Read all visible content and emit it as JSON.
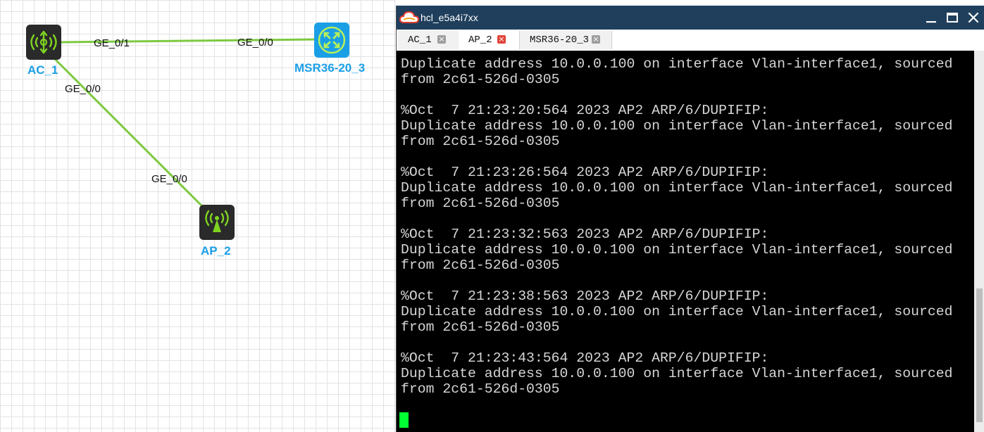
{
  "topology": {
    "devices": [
      {
        "label": "AC_1",
        "icon": "wireless-controller-icon"
      },
      {
        "label": "MSR36-20_3",
        "icon": "router-icon"
      },
      {
        "label": "AP_2",
        "icon": "access-point-icon"
      }
    ],
    "ports": {
      "ac1_to_msr": "GE_0/1",
      "msr_to_ac1": "GE_0/0",
      "ac1_to_ap2": "GE_0/0",
      "ap2_to_ac1": "GE_0/0"
    },
    "colors": {
      "link": "#7dc942",
      "device_bg": "#2a2a2a",
      "device_glyph": "#7ed321",
      "router_bg": "#1a9fe6",
      "label": "#1a9fe6"
    }
  },
  "terminal": {
    "title": "hcl_e5a4i7xx",
    "tabs": [
      {
        "label": "AC_1",
        "active": false
      },
      {
        "label": "AP_2",
        "active": true
      },
      {
        "label": "MSR36-20_3",
        "active": false
      }
    ],
    "console_text": "Duplicate address 10.0.0.100 on interface Vlan-interface1, sourced\nfrom 2c61-526d-0305\n\n%Oct  7 21:23:20:564 2023 AP2 ARP/6/DUPIFIP:\nDuplicate address 10.0.0.100 on interface Vlan-interface1, sourced\nfrom 2c61-526d-0305\n\n%Oct  7 21:23:26:564 2023 AP2 ARP/6/DUPIFIP:\nDuplicate address 10.0.0.100 on interface Vlan-interface1, sourced\nfrom 2c61-526d-0305\n\n%Oct  7 21:23:32:563 2023 AP2 ARP/6/DUPIFIP:\nDuplicate address 10.0.0.100 on interface Vlan-interface1, sourced\nfrom 2c61-526d-0305\n\n%Oct  7 21:23:38:563 2023 AP2 ARP/6/DUPIFIP:\nDuplicate address 10.0.0.100 on interface Vlan-interface1, sourced\nfrom 2c61-526d-0305\n\n%Oct  7 21:23:43:564 2023 AP2 ARP/6/DUPIFIP:\nDuplicate address 10.0.0.100 on interface Vlan-interface1, sourced\nfrom 2c61-526d-0305",
    "icons": {
      "app": "cloud-icon",
      "minimize": "minimize-icon",
      "maximize": "maximize-icon",
      "close": "close-icon",
      "tab_close": "tab-close-icon"
    },
    "colors": {
      "titlebar": "#1f3f5c",
      "console_bg": "#000000",
      "console_text": "#d6d6d6",
      "cursor": "#00ff33",
      "tab_close": "#9e9e9e",
      "tab_close_active": "#e0453a"
    }
  }
}
